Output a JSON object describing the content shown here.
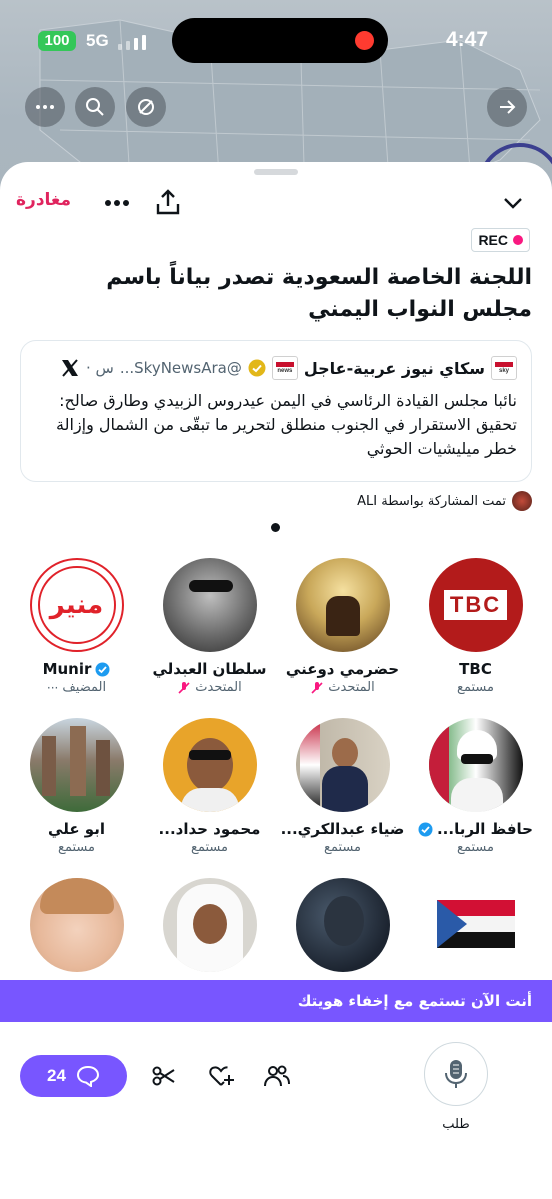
{
  "status_bar": {
    "battery": "100",
    "network": "5G",
    "time": "4:47"
  },
  "header": {
    "leave_label": "مغادرة",
    "rec_label": "REC"
  },
  "space": {
    "title": "اللجنة الخاصة السعودية تصدر بياناً باسم مجلس النواب اليمني"
  },
  "tweet": {
    "author_name": "سكاي نيوز عربية-عاجل",
    "handle": "@SkyNewsAra...",
    "time_ago": "س ·",
    "logo_text": "sky news عربية",
    "body": "نائبا مجلس القيادة الرئاسي في اليمن عيدروس الزبيدي وطارق صالح: تحقيق الاستقرار في الجنوب منطلق لتحرير ما تبقّى من الشمال وإزالة خطر ميليشيات الحوثي"
  },
  "shared_by": {
    "label": "تمت المشاركة بواسطة ALI"
  },
  "participants": [
    {
      "name": "Munir",
      "role": "المضيف",
      "verified": true,
      "avatar_text": "منير"
    },
    {
      "name": "سلطان العبدلي",
      "role": "المتحدث",
      "muted": true
    },
    {
      "name": "حضرمي دوعني",
      "role": "المتحدث",
      "muted": true
    },
    {
      "name": "TBC",
      "role": "مستمع",
      "avatar_text": "TBC"
    },
    {
      "name": "ابو علي",
      "role": "مستمع"
    },
    {
      "name": "محمود حداد...",
      "role": "مستمع"
    },
    {
      "name": "ضياء عبدالكري...",
      "role": "مستمع"
    },
    {
      "name": "حافظ الربا...",
      "role": "مستمع",
      "verified": true
    }
  ],
  "banner": {
    "text": "أنت الآن تستمع مع إخفاء هويتك"
  },
  "bottom_bar": {
    "comment_count": "24",
    "request_label": "طلب"
  },
  "colors": {
    "accent": "#7856ff",
    "leave": "#e0245e",
    "verified": "#1d9bf0"
  }
}
